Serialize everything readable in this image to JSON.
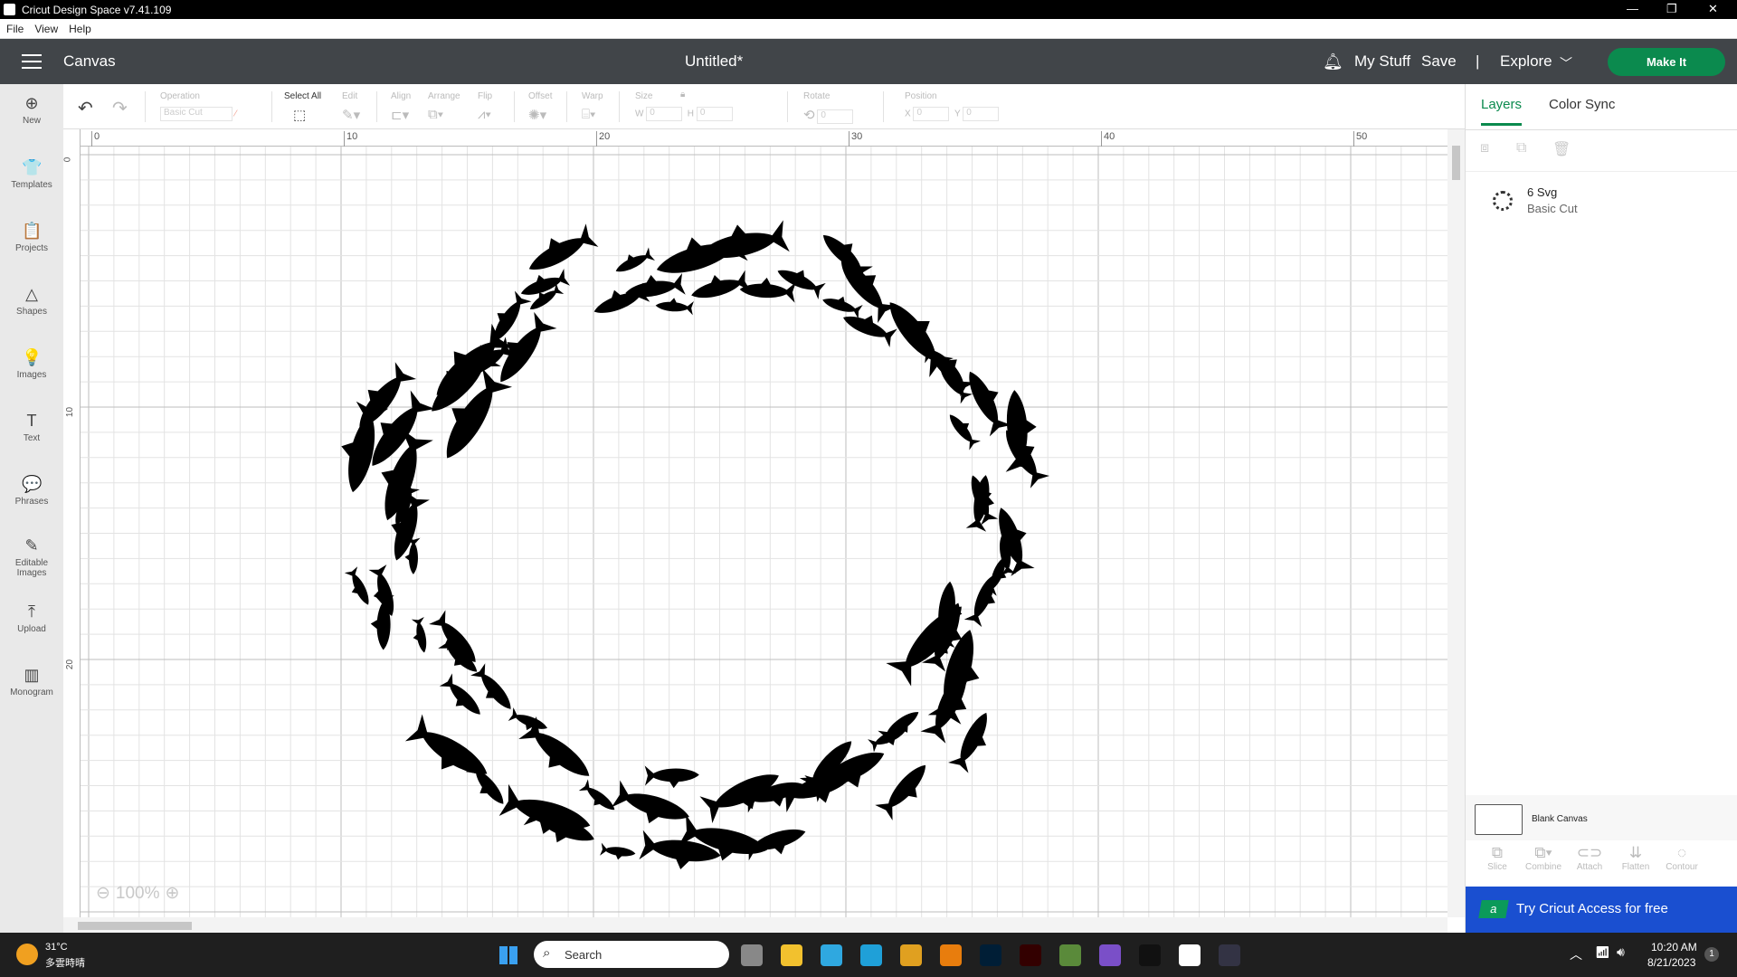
{
  "window": {
    "title": "Cricut Design Space  v7.41.109",
    "min": "—",
    "max": "❐",
    "close": "✕"
  },
  "menu": [
    "File",
    "View",
    "Help"
  ],
  "header": {
    "section": "Canvas",
    "doc_title": "Untitled*",
    "my_stuff": "My Stuff",
    "save": "Save",
    "divider": "|",
    "explore": "Explore",
    "make_it": "Make It"
  },
  "sidebar": [
    {
      "label": "New",
      "icon": "⊕"
    },
    {
      "label": "Templates",
      "icon": "👕"
    },
    {
      "label": "Projects",
      "icon": "📋"
    },
    {
      "label": "Shapes",
      "icon": "△"
    },
    {
      "label": "Images",
      "icon": "💡"
    },
    {
      "label": "Text",
      "icon": "T"
    },
    {
      "label": "Phrases",
      "icon": "💬"
    },
    {
      "label": "Editable Images",
      "icon": "✎"
    },
    {
      "label": "Upload",
      "icon": "⤒"
    },
    {
      "label": "Monogram",
      "icon": "▥"
    }
  ],
  "toolbar": {
    "operation_label": "Operation",
    "operation_value": "Basic Cut",
    "select_all": "Select All",
    "edit": "Edit",
    "align": "Align",
    "arrange": "Arrange",
    "flip": "Flip",
    "offset": "Offset",
    "warp": "Warp",
    "size": "Size",
    "w_label": "W",
    "w_value": "0",
    "h_label": "H",
    "h_value": "0",
    "rotate": "Rotate",
    "rotate_value": "0",
    "position": "Position",
    "x_label": "X",
    "x_value": "0",
    "y_label": "Y",
    "y_value": "0"
  },
  "ruler": {
    "top": [
      "0",
      "10",
      "20",
      "30",
      "40",
      "50"
    ],
    "left": [
      "0",
      "10",
      "20"
    ]
  },
  "zoom": {
    "level": "100%",
    "minus": "⊖",
    "plus": "⊕"
  },
  "panel": {
    "tabs": [
      "Layers",
      "Color Sync"
    ],
    "layer_name": "6 Svg",
    "layer_op": "Basic Cut",
    "blank_canvas": "Blank Canvas",
    "tools": [
      "Slice",
      "Combine",
      "Attach",
      "Flatten",
      "Contour"
    ],
    "banner": "Try Cricut Access for free",
    "banner_logo": "a"
  },
  "taskbar": {
    "temp": "31°C",
    "weather": "多雲時晴",
    "search": "Search",
    "time": "10:20 AM",
    "date": "8/21/2023",
    "notif": "1"
  }
}
